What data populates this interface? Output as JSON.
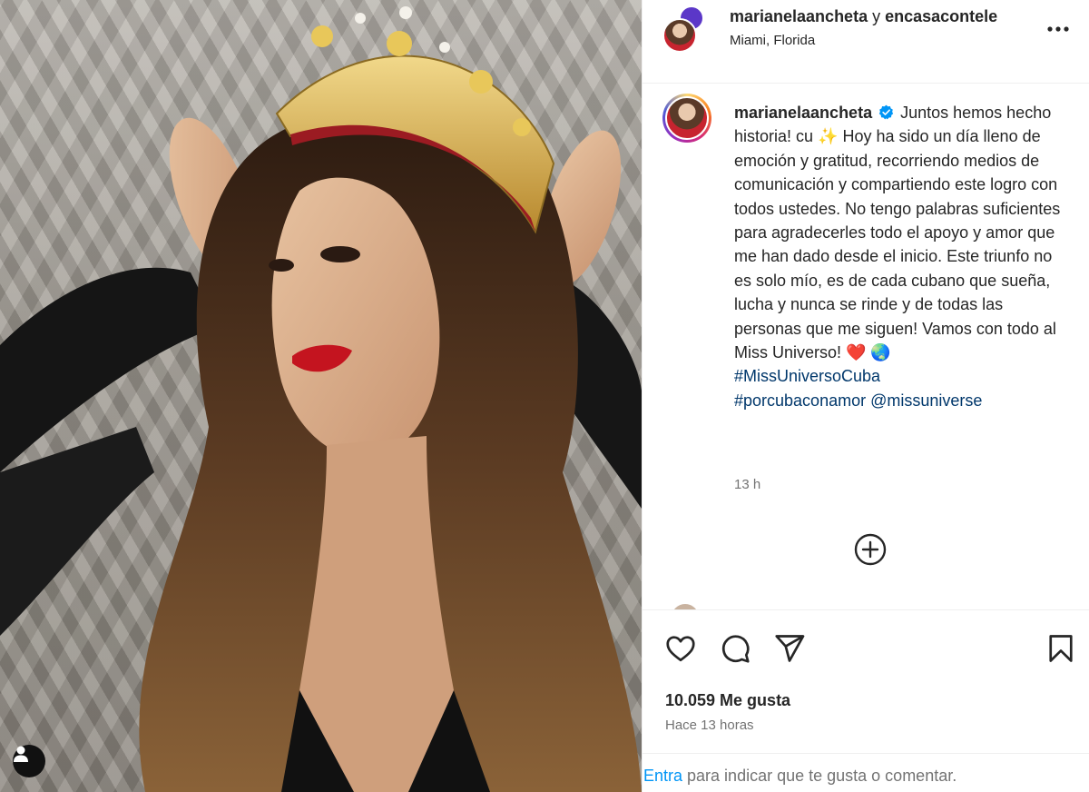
{
  "post": {
    "header": {
      "author": "marianelaancheta",
      "connector": "y",
      "coauthor": "encasacontele",
      "location": "Miami, Florida"
    },
    "caption": {
      "username": "marianelaancheta",
      "text": "Juntos hemos hecho historia! cu ✨ Hoy ha sido un día lleno de emoción y gratitud, recorriendo medios de comunicación y compartiendo este logro con todos ustedes. No tengo palabras suficientes para agradecerles todo el apoyo y amor que me han dado desde el inicio. Este triunfo no es solo mío, es de cada cubano que sueña, lucha y nunca se rinde y de todas las personas que me siguen! Vamos con todo al Miss Universo! ❤️ 🌏",
      "hashtags": [
        "#MissUniversoCuba",
        "#porcubaconamor"
      ],
      "mention": "@missuniverse",
      "time": "13 h"
    },
    "likes_text": "10.059 Me gusta",
    "posted_text": "Hace 13 horas"
  },
  "footer": {
    "link": "Entra",
    "text": " para indicar que te gusta o comentar."
  },
  "icons": {
    "more": "more-horizontal-icon",
    "verified": "verified-badge-icon",
    "add_comment": "plus-circle-icon",
    "like": "heart-icon",
    "comment": "comment-bubble-icon",
    "share": "paper-plane-icon",
    "save": "bookmark-icon",
    "user_tag": "user-tag-icon"
  },
  "colors": {
    "link_blue": "#0095f6",
    "hashtag": "#00376b",
    "verified": "#0095f6",
    "muted": "#737373"
  }
}
